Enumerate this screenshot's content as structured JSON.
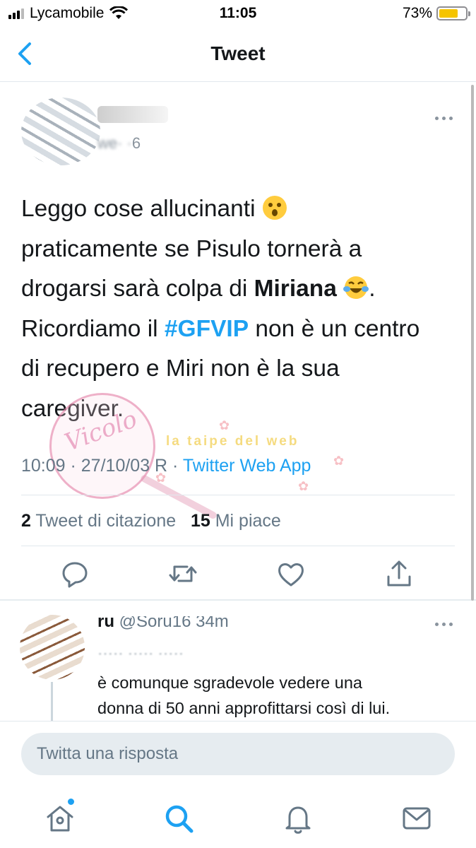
{
  "status_bar": {
    "carrier": "Lycamobile",
    "time": "11:05",
    "battery": "73%",
    "battery_level": 0.73
  },
  "nav": {
    "title": "Tweet",
    "back_icon": "chevron-left-icon"
  },
  "tweet": {
    "handle_partial": "6",
    "text": {
      "line1": "Leggo cose allucinanti ",
      "line2": "praticamente se Pisulo tornerà a",
      "line3_a": "drogarsi sarà colpa di ",
      "line3_bold": "Miriana",
      "line3_end": ".",
      "line4_a": "Ricordiamo il ",
      "hashtag": "#GFVIP",
      "line4_b": " non è un centro",
      "line5": "di recupero e Miri non è la sua",
      "line6": "caregiver."
    },
    "meta": {
      "time": "10:09",
      "date": "27/10/03 R",
      "source": "Twitter Web App"
    },
    "stats": {
      "quotes_count": "2",
      "quotes_label": "Tweet di citazione",
      "likes_count": "15",
      "likes_label": "Mi piace"
    }
  },
  "reply": {
    "name_partial": "ru",
    "handle": "@Soru16",
    "age": "34m",
    "text_line1": "è comunque sgradevole vedere una",
    "text_line2": "donna di 50 anni approfittarsi così di lui."
  },
  "watermark": {
    "line1": "Vicolo",
    "line2": "la taipe del web"
  },
  "compose": {
    "placeholder": "Twitta una risposta"
  },
  "tabs": [
    "home-icon",
    "search-icon",
    "notifications-icon",
    "messages-icon"
  ],
  "colors": {
    "accent": "#1da1f2",
    "text": "#14171a",
    "muted": "#657786",
    "battery": "#f5c400"
  }
}
